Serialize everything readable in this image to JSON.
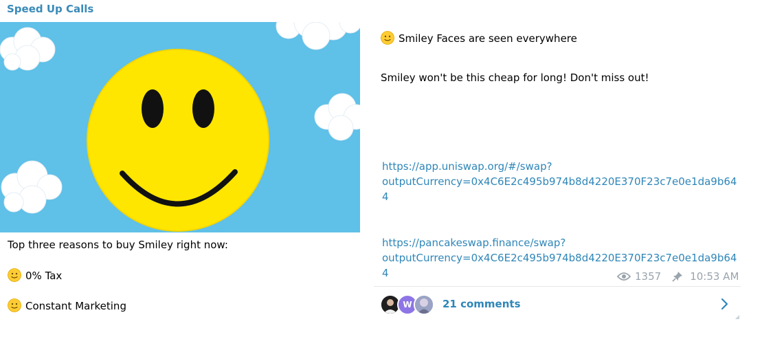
{
  "channel": {
    "title": "Speed Up Calls"
  },
  "left_text": {
    "intro": "Top three reasons to buy Smiley right now:",
    "reason1": "0% Tax",
    "reason2": "Constant Marketing"
  },
  "right_text": {
    "line1": "Smiley Faces are seen everywhere",
    "line2": "Smiley won't be this cheap for long!  Don't miss out!",
    "link1": "https://app.uniswap.org/#/swap?\noutputCurrency=0x4C6E2c495b974b8d4220E370F23c7e0e1da9b64\n4",
    "link2": "https://pancakeswap.finance/swap?\noutputCurrency=0x4C6E2c495b974b8d4220E370F23c7e0e1da9b64\n4"
  },
  "meta": {
    "views": "1357",
    "time": "10:53 AM"
  },
  "comments": {
    "label": "21 comments",
    "avatar2_letter": "W"
  },
  "icons": {
    "emoji": "slightly-smiling-face-icon",
    "views": "eye-icon",
    "pinned": "pin-icon",
    "open": "chevron-right-icon"
  },
  "colors": {
    "link": "#2e86b8",
    "title": "#3a8ab8",
    "sky": "#5fc0e8",
    "smiley": "#ffe600"
  }
}
